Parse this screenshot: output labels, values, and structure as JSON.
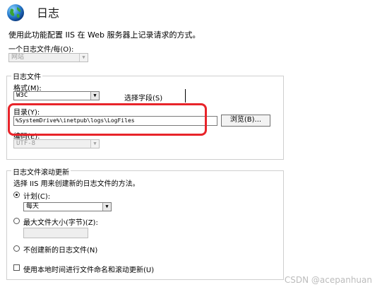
{
  "header": {
    "title": "日志",
    "description": "使用此功能配置 IIS 在 Web 服务器上记录请求的方式。"
  },
  "one_log_per": {
    "label": "一个日志文件/每(O):",
    "value": "网站"
  },
  "log_file": {
    "group_title": "日志文件",
    "format_label": "格式(M):",
    "format_value": "W3C",
    "select_fields_button": "选择字段(S)",
    "directory_label": "目录(Y):",
    "directory_value": "%SystemDrive%\\inetpub\\logs\\LogFiles",
    "browse_button": "浏览(B)...",
    "encoding_label": "编码(E):",
    "encoding_value": "UTF-8"
  },
  "rollover": {
    "group_title": "日志文件滚动更新",
    "description": "选择 IIS 用来创建新的日志文件的方法。",
    "schedule_label": "计划(C):",
    "schedule_value": "每天",
    "max_size_label": "最大文件大小(字节)(Z):",
    "max_size_value": "",
    "no_new_label": "不创建新的日志文件(N)",
    "local_time_label": "使用本地时间进行文件命名和滚动更新(U)"
  },
  "watermark": "CSDN @acepanhuan",
  "colors": {
    "highlight": "#e8242a"
  }
}
